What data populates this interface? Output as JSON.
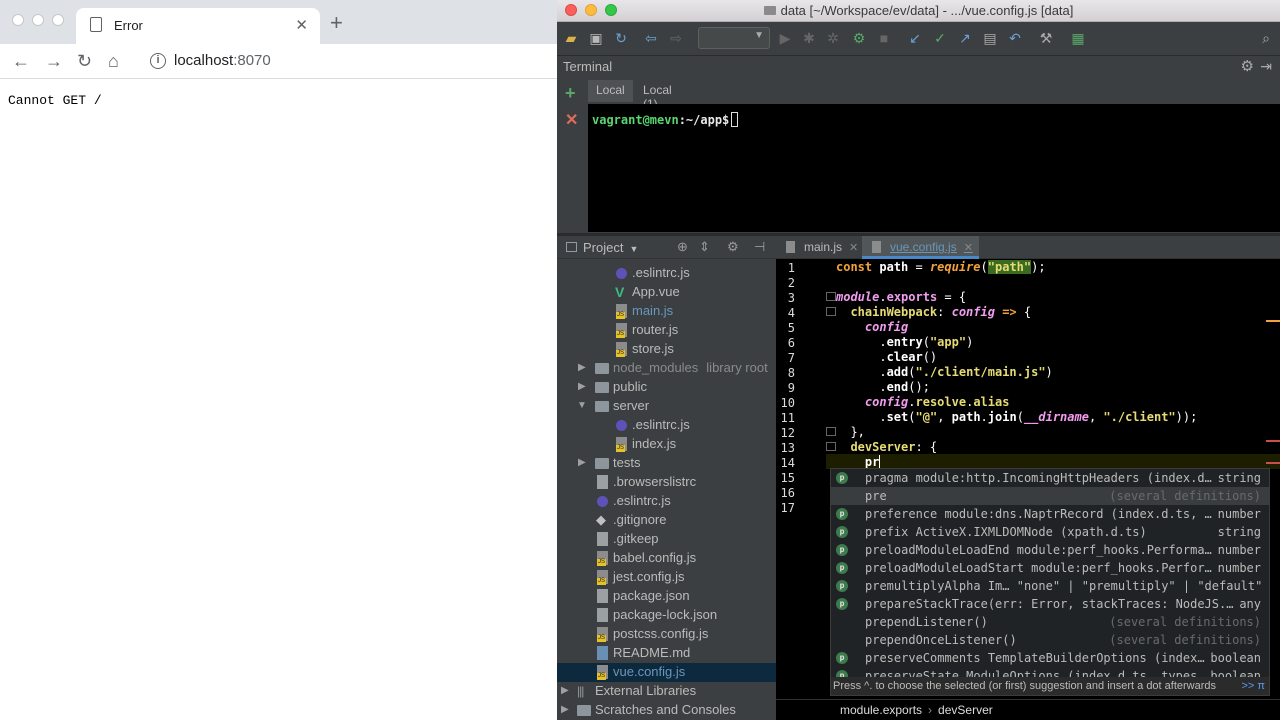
{
  "browser": {
    "tab_title": "Error",
    "url_host": "localhost",
    "url_port": ":8070",
    "page_text": "Cannot GET /"
  },
  "ide": {
    "window_title": "data [~/Workspace/ev/data] - .../vue.config.js [data]",
    "terminal": {
      "title": "Terminal",
      "tabs": [
        "Local",
        "Local (1)"
      ],
      "prompt_user": "vagrant@mevn",
      "prompt_path": ":~/app$"
    },
    "project": {
      "title": "Project",
      "tree": [
        {
          "label": ".eslintrc.js",
          "icon": "eslint"
        },
        {
          "label": "App.vue",
          "icon": "vue"
        },
        {
          "label": "main.js",
          "icon": "js"
        },
        {
          "label": "router.js",
          "icon": "js"
        },
        {
          "label": "store.js",
          "icon": "js"
        },
        {
          "label": "node_modules",
          "hint": "library root",
          "icon": "folder"
        },
        {
          "label": "public",
          "icon": "folder"
        },
        {
          "label": "server",
          "icon": "folder"
        },
        {
          "label": ".eslintrc.js",
          "icon": "eslint"
        },
        {
          "label": "index.js",
          "icon": "js"
        },
        {
          "label": "tests",
          "icon": "folder"
        },
        {
          "label": ".browserslistrc",
          "icon": "file"
        },
        {
          "label": ".eslintrc.js",
          "icon": "eslint"
        },
        {
          "label": ".gitignore",
          "icon": "git"
        },
        {
          "label": ".gitkeep",
          "icon": "file"
        },
        {
          "label": "babel.config.js",
          "icon": "js"
        },
        {
          "label": "jest.config.js",
          "icon": "js"
        },
        {
          "label": "package.json",
          "icon": "file"
        },
        {
          "label": "package-lock.json",
          "icon": "file"
        },
        {
          "label": "postcss.config.js",
          "icon": "js"
        },
        {
          "label": "README.md",
          "icon": "file"
        },
        {
          "label": "vue.config.js",
          "icon": "js"
        },
        {
          "label": "External Libraries",
          "icon": "library"
        },
        {
          "label": "Scratches and Consoles",
          "icon": "folder"
        }
      ]
    },
    "editor": {
      "tabs": [
        "main.js",
        "vue.config.js"
      ],
      "line_numbers": [
        "1",
        "2",
        "3",
        "4",
        "5",
        "6",
        "7",
        "8",
        "9",
        "10",
        "11",
        "12",
        "13",
        "14",
        "15",
        "16",
        "17"
      ],
      "breadcrumb": [
        "module.exports",
        "devServer"
      ]
    },
    "autocomplete": {
      "items": [
        {
          "name": "pragma module:http.IncomingHttpHeaders (index.d…",
          "type": "string",
          "badge": "p"
        },
        {
          "name": "pre",
          "type": "(several definitions)",
          "badge": ""
        },
        {
          "name": "preference module:dns.NaptrRecord (index.d.ts, …",
          "type": "number",
          "badge": "p"
        },
        {
          "name": "prefix ActiveX.IXMLDOMNode (xpath.d.ts)",
          "type": "string",
          "badge": "p"
        },
        {
          "name": "preloadModuleLoadEnd module:perf_hooks.Performa…",
          "type": "number",
          "badge": "p"
        },
        {
          "name": "preloadModuleLoadStart module:perf_hooks.Perfor…",
          "type": "number",
          "badge": "p"
        },
        {
          "name": "premultiplyAlpha Im…   \"none\" | \"premultiply\" | \"default\"",
          "type": "",
          "badge": "p"
        },
        {
          "name": "prepareStackTrace(err: Error, stackTraces: NodeJS.…",
          "type": "any",
          "badge": "p"
        },
        {
          "name": "prependListener()",
          "type": "(several definitions)",
          "badge": ""
        },
        {
          "name": "prependOnceListener()",
          "type": "(several definitions)",
          "badge": ""
        },
        {
          "name": "preserveComments TemplateBuilderOptions (index…",
          "type": "boolean",
          "badge": "p"
        },
        {
          "name": "preserveState ModuleOptions (index.d.ts, types…",
          "type": "boolean",
          "badge": "p"
        }
      ],
      "footer": "Press ^. to choose the selected (or first) suggestion and insert a dot afterwards",
      "footer_link": ">> π"
    }
  }
}
